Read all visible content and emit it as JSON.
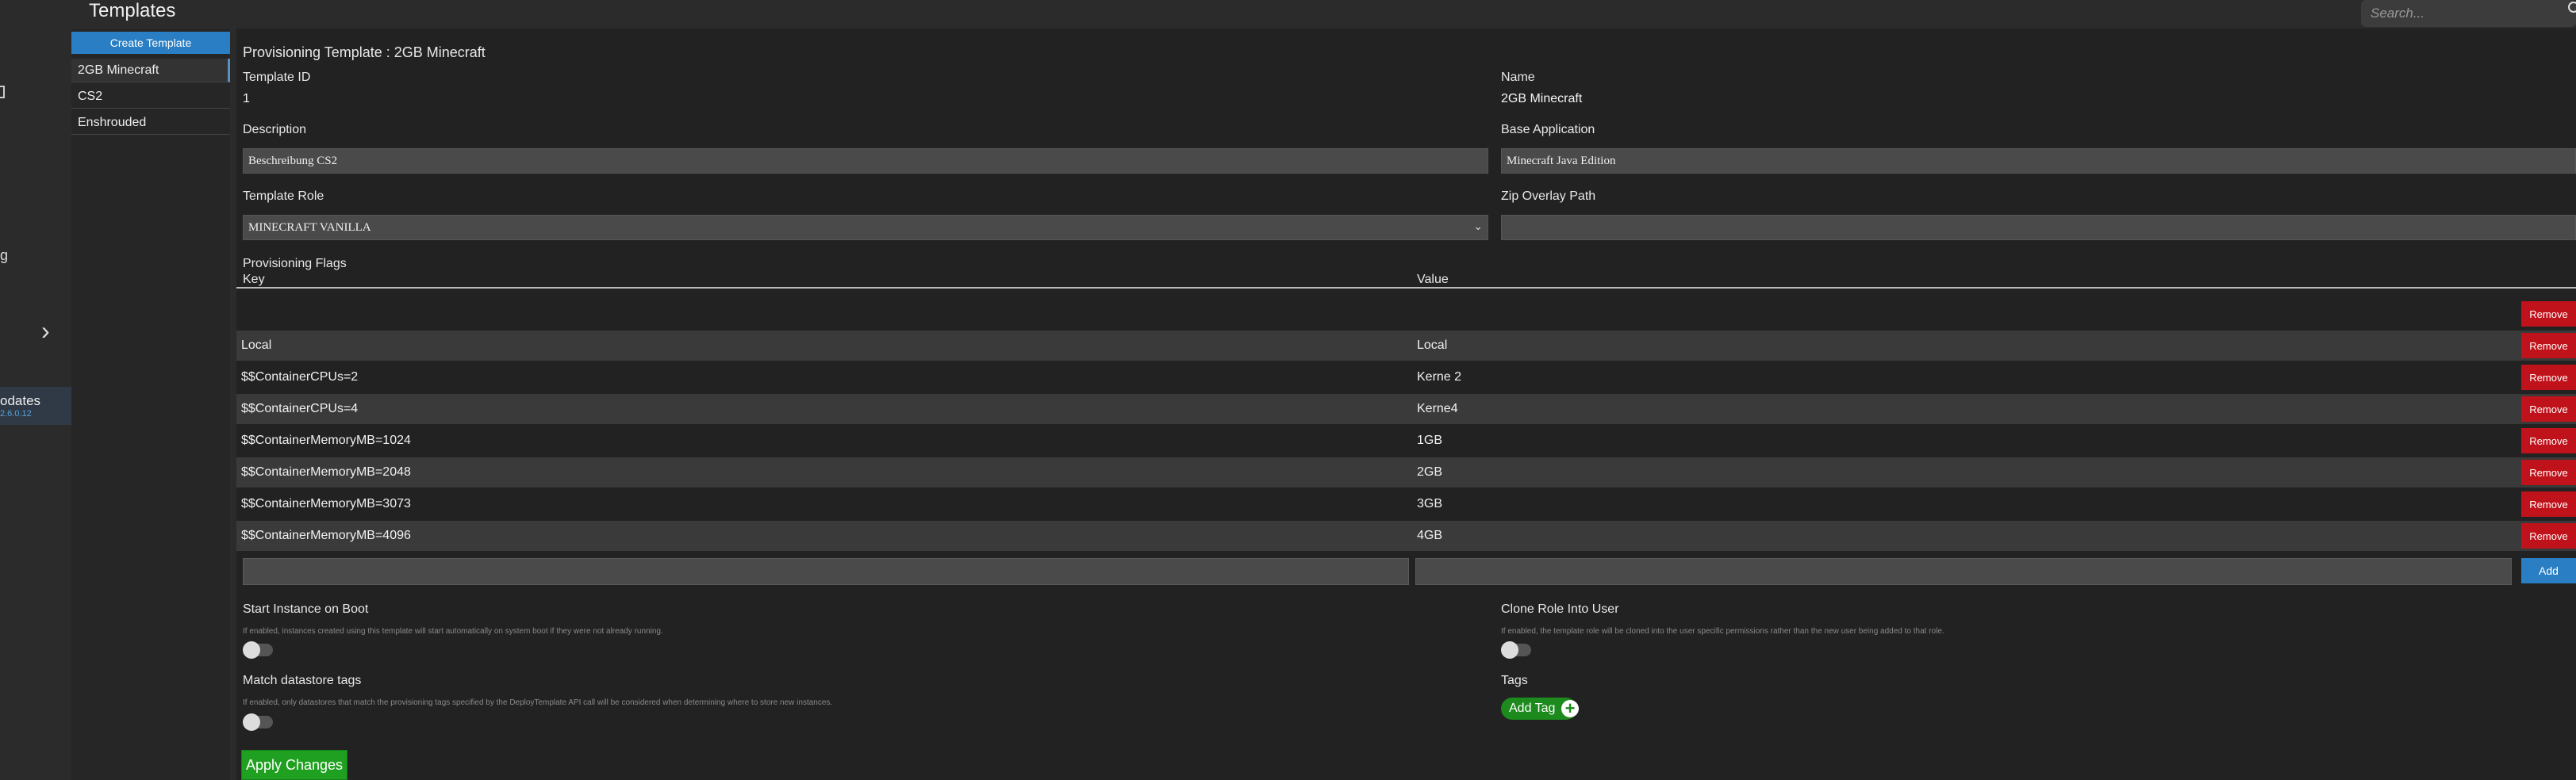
{
  "header": {
    "title": "Templates",
    "search_placeholder": "Search..."
  },
  "leftnav": {
    "partial_text": "g",
    "updates_label": "odates",
    "updates_version": "2.6.0.12"
  },
  "templates": {
    "create_label": "Create Template",
    "items": [
      {
        "label": "2GB Minecraft",
        "active": true
      },
      {
        "label": "CS2",
        "active": false
      },
      {
        "label": "Enshrouded",
        "active": false
      }
    ]
  },
  "editor": {
    "heading": "Provisioning Template : 2GB Minecraft",
    "template_id_label": "Template ID",
    "template_id_value": "1",
    "name_label": "Name",
    "name_value": "2GB Minecraft",
    "description_label": "Description",
    "description_value": "Beschreibung CS2",
    "base_app_label": "Base Application",
    "base_app_value": "Minecraft Java Edition",
    "role_label": "Template Role",
    "role_value": "MINECRAFT VANILLA",
    "zip_label": "Zip Overlay Path",
    "zip_value": "",
    "flags_title": "Provisioning Flags",
    "flags_key_header": "Key",
    "flags_value_header": "Value",
    "remove_label": "Remove",
    "add_label": "Add",
    "flags": [
      {
        "key": "",
        "value": ""
      },
      {
        "key": "Local",
        "value": "Local"
      },
      {
        "key": "$$ContainerCPUs=2",
        "value": "Kerne 2"
      },
      {
        "key": "$$ContainerCPUs=4",
        "value": "Kerne4"
      },
      {
        "key": "$$ContainerMemoryMB=1024",
        "value": "1GB"
      },
      {
        "key": "$$ContainerMemoryMB=2048",
        "value": "2GB"
      },
      {
        "key": "$$ContainerMemoryMB=3073",
        "value": "3GB"
      },
      {
        "key": "$$ContainerMemoryMB=4096",
        "value": "4GB"
      }
    ],
    "start_on_boot_label": "Start Instance on Boot",
    "start_on_boot_help": "If enabled, instances created using this template will start automatically on system boot if they were not already running.",
    "start_on_boot_enabled": false,
    "clone_role_label": "Clone Role Into User",
    "clone_role_help": "If enabled, the template role will be cloned into the user specific permissions rather than the new user being added to that role.",
    "clone_role_enabled": false,
    "match_tags_label": "Match datastore tags",
    "match_tags_help": "If enabled, only datastores that match the provisioning tags specified by the DeployTemplate API call will be considered when determining where to store new instances.",
    "match_tags_enabled": false,
    "tags_label": "Tags",
    "add_tag_label": "Add Tag",
    "apply_label": "Apply Changes"
  },
  "colors": {
    "accent_blue": "#2a7ec3",
    "remove_red": "#c0121a",
    "apply_green": "#20a020"
  }
}
